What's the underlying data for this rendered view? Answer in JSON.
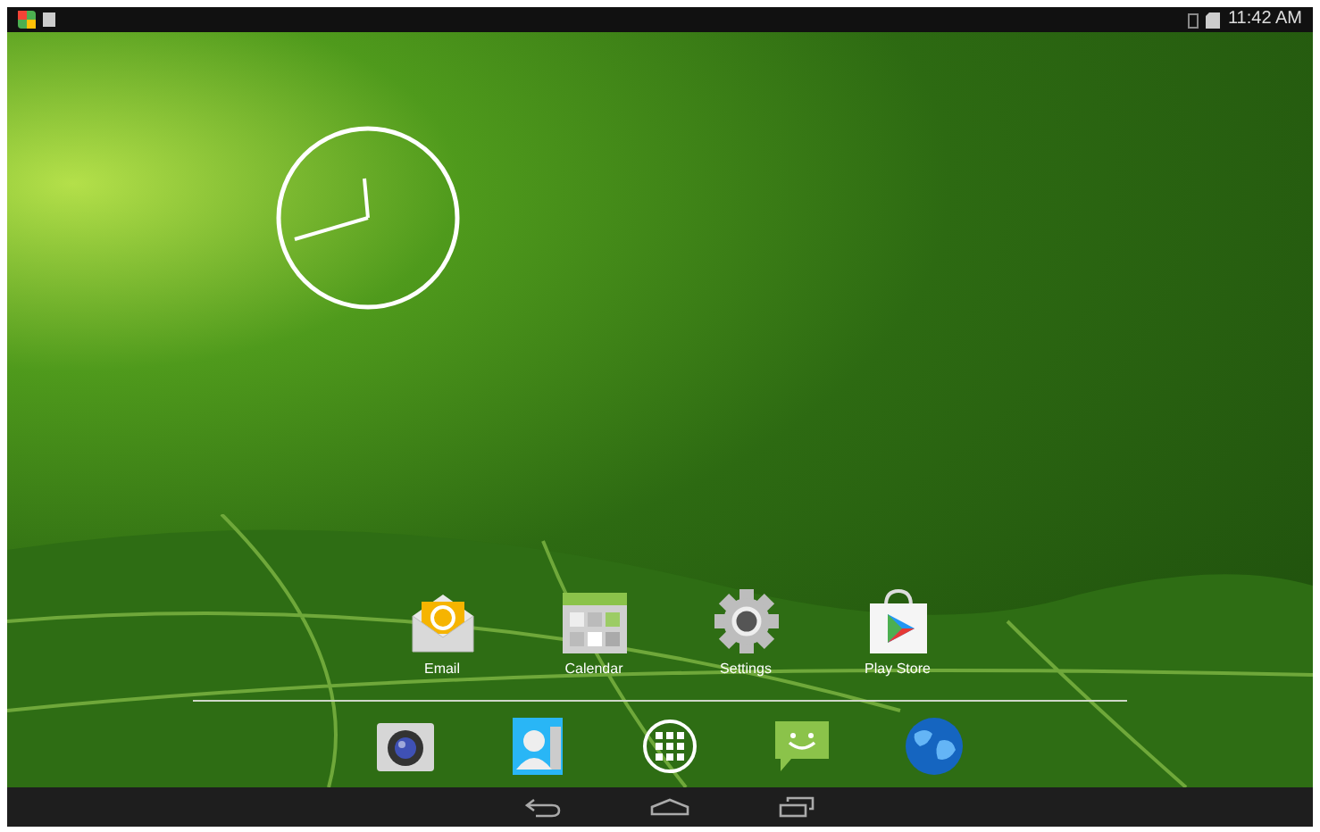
{
  "status_bar": {
    "time": "11:42 AM"
  },
  "home_apps": [
    {
      "kind": "email",
      "label": "Email"
    },
    {
      "kind": "calendar",
      "label": "Calendar"
    },
    {
      "kind": "settings",
      "label": "Settings"
    },
    {
      "kind": "store",
      "label": "Play Store"
    }
  ],
  "dock": [
    {
      "kind": "camera"
    },
    {
      "kind": "contacts"
    },
    {
      "kind": "apps"
    },
    {
      "kind": "messaging"
    },
    {
      "kind": "browser"
    }
  ]
}
